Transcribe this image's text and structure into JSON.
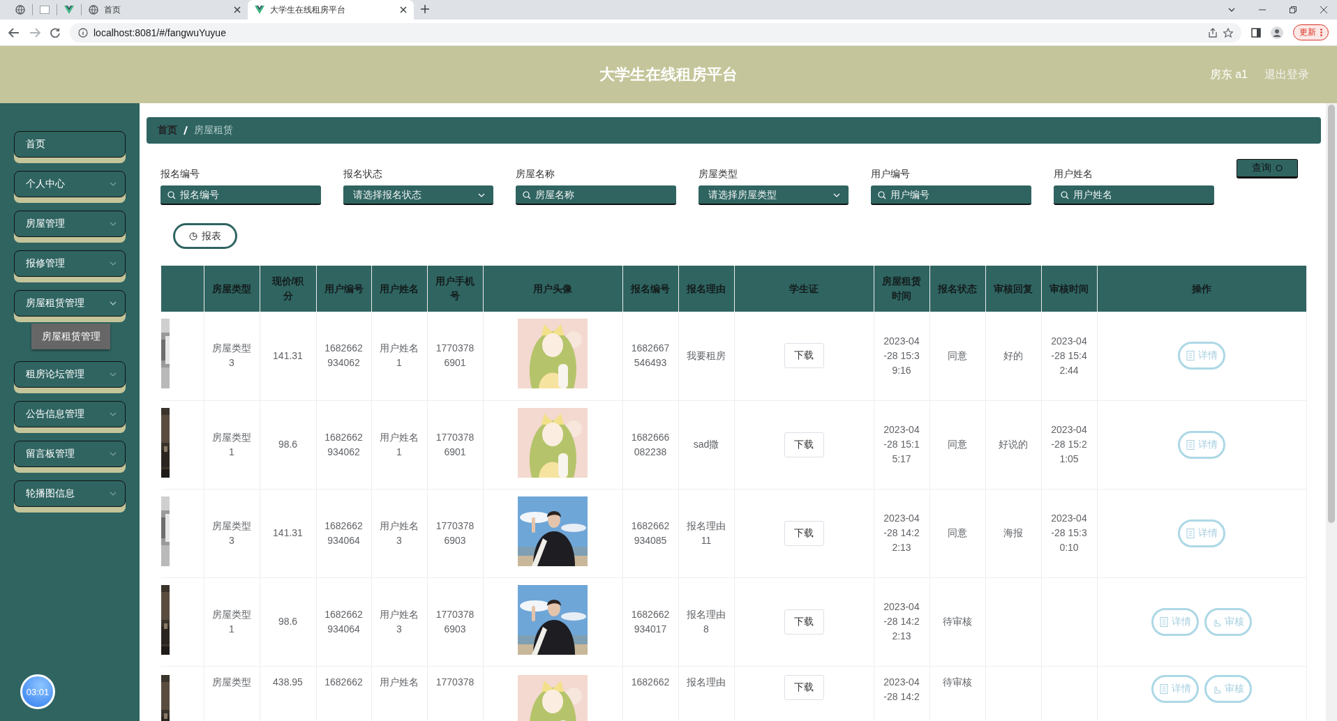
{
  "browser": {
    "tabs": [
      {
        "title": "首页",
        "selected": false
      },
      {
        "title": "大学生在线租房平台",
        "selected": true
      }
    ],
    "address": "localhost:8081/#/fangwuYuyue",
    "update_button": "更新"
  },
  "header": {
    "title": "大学生在线租房平台",
    "user": "房东 a1",
    "logout": "退出登录"
  },
  "sidebar": {
    "items": [
      {
        "label": "首页",
        "has_submenu": false
      },
      {
        "label": "个人中心",
        "has_submenu": true,
        "expanded": false
      },
      {
        "label": "房屋管理",
        "has_submenu": true,
        "expanded": false
      },
      {
        "label": "报修管理",
        "has_submenu": true,
        "expanded": false
      },
      {
        "label": "房屋租赁管理",
        "has_submenu": true,
        "expanded": true,
        "children": [
          {
            "label": "房屋租赁管理",
            "selected": true
          }
        ]
      },
      {
        "label": "租房论坛管理",
        "has_submenu": true,
        "expanded": false
      },
      {
        "label": "公告信息管理",
        "has_submenu": true,
        "expanded": false
      },
      {
        "label": "留言板管理",
        "has_submenu": true,
        "expanded": false
      },
      {
        "label": "轮播图信息",
        "has_submenu": true,
        "expanded": false
      }
    ],
    "timer": "03:01"
  },
  "breadcrumb": [
    {
      "label": "首页",
      "current": false
    },
    {
      "label": "房屋租赁",
      "current": true
    }
  ],
  "filters": [
    {
      "label": "报名编号",
      "kind": "text",
      "placeholder": "报名编号"
    },
    {
      "label": "报名状态",
      "kind": "select",
      "placeholder": "请选择报名状态"
    },
    {
      "label": "房屋名称",
      "kind": "text",
      "placeholder": "房屋名称"
    },
    {
      "label": "房屋类型",
      "kind": "select",
      "placeholder": "请选择房屋类型"
    },
    {
      "label": "用户编号",
      "kind": "text",
      "placeholder": "用户编号"
    },
    {
      "label": "用户姓名",
      "kind": "text",
      "placeholder": "用户姓名"
    }
  ],
  "query_button": "查询",
  "report_button": "报表",
  "table": {
    "columns": [
      "房屋类型",
      "现价/积分",
      "用户编号",
      "用户姓名",
      "用户手机号",
      "用户头像",
      "报名编号",
      "报名理由",
      "学生证",
      "房屋租赁时间",
      "报名状态",
      "审核回复",
      "审核时间",
      "操作"
    ],
    "rows": [
      {
        "house_type": "房屋类型3",
        "price": "141.31",
        "user_no": "1682662934062",
        "user_name": "用户姓名1",
        "phone": "17703786901",
        "signup_no": "1682667546493",
        "reason": "我要租房",
        "student_card": "下载",
        "rent_time": "2023-04-28 15:39:16",
        "status": "同意",
        "reply": "好的",
        "review_time": "2023-04-28 15:42:44",
        "actions": [
          {
            "label": "详情",
            "kind": "detail"
          }
        ]
      },
      {
        "house_type": "房屋类型1",
        "price": "98.6",
        "user_no": "1682662934062",
        "user_name": "用户姓名1",
        "phone": "17703786901",
        "signup_no": "1682666082238",
        "reason": "sad撒",
        "student_card": "下载",
        "rent_time": "2023-04-28 15:15:17",
        "status": "同意",
        "reply": "好说的",
        "review_time": "2023-04-28 15:21:05",
        "actions": [
          {
            "label": "详情",
            "kind": "detail"
          }
        ]
      },
      {
        "house_type": "房屋类型3",
        "price": "141.31",
        "user_no": "1682662934064",
        "user_name": "用户姓名3",
        "phone": "17703786903",
        "signup_no": "1682662934085",
        "reason": "报名理由11",
        "student_card": "下载",
        "rent_time": "2023-04-28 14:22:13",
        "status": "同意",
        "reply": "海报",
        "review_time": "2023-04-28 15:30:10",
        "actions": [
          {
            "label": "详情",
            "kind": "detail"
          }
        ]
      },
      {
        "house_type": "房屋类型1",
        "price": "98.6",
        "user_no": "1682662934064",
        "user_name": "用户姓名3",
        "phone": "17703786903",
        "signup_no": "1682662934017",
        "reason": "报名理由8",
        "student_card": "下载",
        "rent_time": "2023-04-28 14:22:13",
        "status": "待审核",
        "actions": [
          {
            "label": "详情",
            "kind": "detail"
          },
          {
            "label": "审核",
            "kind": "review"
          }
        ]
      },
      {
        "house_type": "房屋类型",
        "price": "438.95",
        "user_no": "1682662",
        "user_name": "用户姓名",
        "phone": "1770378",
        "signup_no": "1682662",
        "reason": "报名理由",
        "student_card": "下载",
        "rent_time": "2023-04-28 14:2",
        "status": "待审核",
        "actions": [
          {
            "label": "详情",
            "kind": "detail"
          },
          {
            "label": "审核",
            "kind": "review"
          }
        ]
      }
    ]
  }
}
